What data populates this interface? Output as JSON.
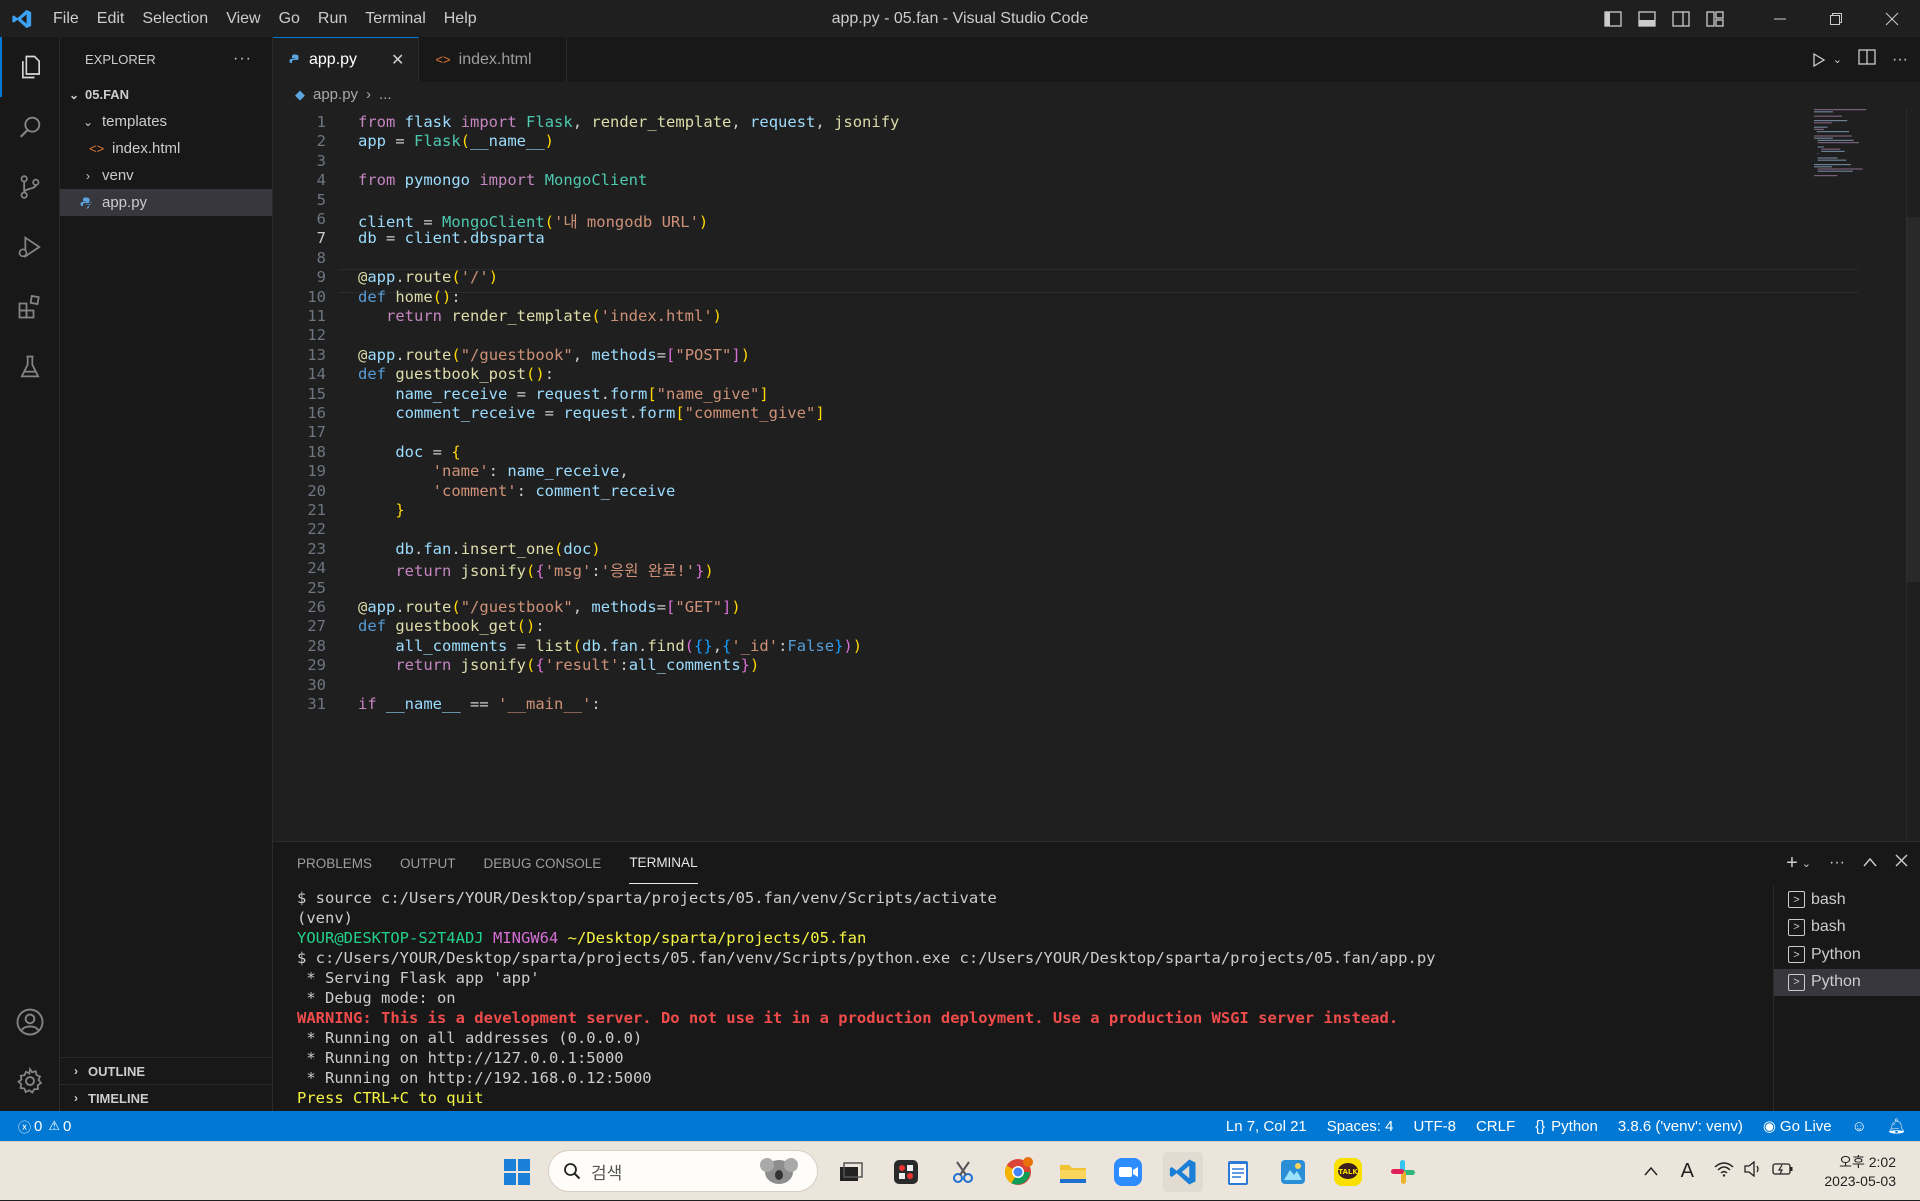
{
  "titlebar": {
    "menus": [
      "File",
      "Edit",
      "Selection",
      "View",
      "Go",
      "Run",
      "Terminal",
      "Help"
    ],
    "window_title": "app.py - 05.fan - Visual Studio Code",
    "window_buttons": [
      "minimize",
      "restore",
      "close"
    ]
  },
  "activitybar": [
    "explorer-icon",
    "search-icon",
    "source-control-icon",
    "run-debug-icon",
    "extensions-icon",
    "testing-icon",
    "account-icon",
    "gear-icon"
  ],
  "sidebar": {
    "title": "EXPLORER",
    "more": "···",
    "root": "05.FAN",
    "tree": [
      {
        "label": "templates",
        "kind": "folder",
        "expanded": true
      },
      {
        "label": "index.html",
        "kind": "html"
      },
      {
        "label": "venv",
        "kind": "folder",
        "expanded": false
      },
      {
        "label": "app.py",
        "kind": "python",
        "selected": true
      }
    ],
    "outline": "OUTLINE",
    "timeline": "TIMELINE"
  },
  "tabs": [
    {
      "label": "app.py",
      "active": true,
      "close": "✕"
    },
    {
      "label": "index.html",
      "active": false
    }
  ],
  "breadcrumb": {
    "file": "app.py",
    "rest": "..."
  },
  "editor": {
    "current_line": 7,
    "lines": [
      {
        "n": "1",
        "t": "from flask import Flask, render_template, request, jsonify"
      },
      {
        "n": "2",
        "t": "app = Flask(__name__)"
      },
      {
        "n": "3",
        "t": ""
      },
      {
        "n": "4",
        "t": "from pymongo import MongoClient"
      },
      {
        "n": "5",
        "t": ""
      },
      {
        "n": "6",
        "t": "client = MongoClient('내 mongodb URL')"
      },
      {
        "n": "7",
        "t": "db = client.dbsparta"
      },
      {
        "n": "8",
        "t": ""
      },
      {
        "n": "9",
        "t": "@app.route('/')"
      },
      {
        "n": "10",
        "t": "def home():"
      },
      {
        "n": "11",
        "t": "   return render_template('index.html')"
      },
      {
        "n": "12",
        "t": ""
      },
      {
        "n": "13",
        "t": "@app.route(\"/guestbook\", methods=[\"POST\"])"
      },
      {
        "n": "14",
        "t": "def guestbook_post():"
      },
      {
        "n": "15",
        "t": "    name_receive = request.form[\"name_give\"]"
      },
      {
        "n": "16",
        "t": "    comment_receive = request.form[\"comment_give\"]"
      },
      {
        "n": "17",
        "t": ""
      },
      {
        "n": "18",
        "t": "    doc = {"
      },
      {
        "n": "19",
        "t": "        'name': name_receive,"
      },
      {
        "n": "20",
        "t": "        'comment': comment_receive"
      },
      {
        "n": "21",
        "t": "    }"
      },
      {
        "n": "22",
        "t": ""
      },
      {
        "n": "23",
        "t": "    db.fan.insert_one(doc)"
      },
      {
        "n": "24",
        "t": "    return jsonify({'msg':'응원 완료!'})"
      },
      {
        "n": "25",
        "t": ""
      },
      {
        "n": "26",
        "t": "@app.route(\"/guestbook\", methods=[\"GET\"])"
      },
      {
        "n": "27",
        "t": "def guestbook_get():"
      },
      {
        "n": "28",
        "t": "    all_comments = list(db.fan.find({},{'_id':False}))"
      },
      {
        "n": "29",
        "t": "    return jsonify({'result':all_comments})"
      },
      {
        "n": "30",
        "t": ""
      },
      {
        "n": "31",
        "t": "if __name__ == '__main__':"
      }
    ]
  },
  "panel": {
    "tabs": [
      "PROBLEMS",
      "OUTPUT",
      "DEBUG CONSOLE",
      "TERMINAL"
    ],
    "active_tab": "TERMINAL",
    "terminal_lines": [
      "$ source c:/Users/YOUR/Desktop/sparta/projects/05.fan/venv/Scripts/activate",
      "(venv)",
      "YOUR@DESKTOP-S2T4ADJ MINGW64 ~/Desktop/sparta/projects/05.fan",
      "$ c:/Users/YOUR/Desktop/sparta/projects/05.fan/venv/Scripts/python.exe c:/Users/YOUR/Desktop/sparta/projects/05.fan/app.py",
      " * Serving Flask app 'app'",
      " * Debug mode: on",
      "WARNING: This is a development server. Do not use it in a production deployment. Use a production WSGI server instead.",
      " * Running on all addresses (0.0.0.0)",
      " * Running on http://127.0.0.1:5000",
      " * Running on http://192.168.0.12:5000",
      "Press CTRL+C to quit"
    ],
    "terminals": [
      "bash",
      "bash",
      "Python",
      "Python"
    ]
  },
  "statusbar": {
    "errors": "0",
    "warnings": "0",
    "position": "Ln 7, Col 21",
    "spaces": "Spaces: 4",
    "encoding": "UTF-8",
    "eol": "CRLF",
    "language": "Python",
    "interpreter": "3.8.6 ('venv': venv)",
    "golive": "Go Live"
  },
  "taskbar": {
    "search_placeholder": "검색",
    "clock_time": "오후 2:02",
    "clock_date": "2023-05-03",
    "ime": "A"
  },
  "colors": {
    "accent": "#0078d4",
    "status_bar": "#0078d4",
    "warning_text": "#f14c4c",
    "prompt_green": "#23d18b",
    "prompt_magenta": "#d670d6",
    "prompt_yellow": "#f5f543"
  }
}
